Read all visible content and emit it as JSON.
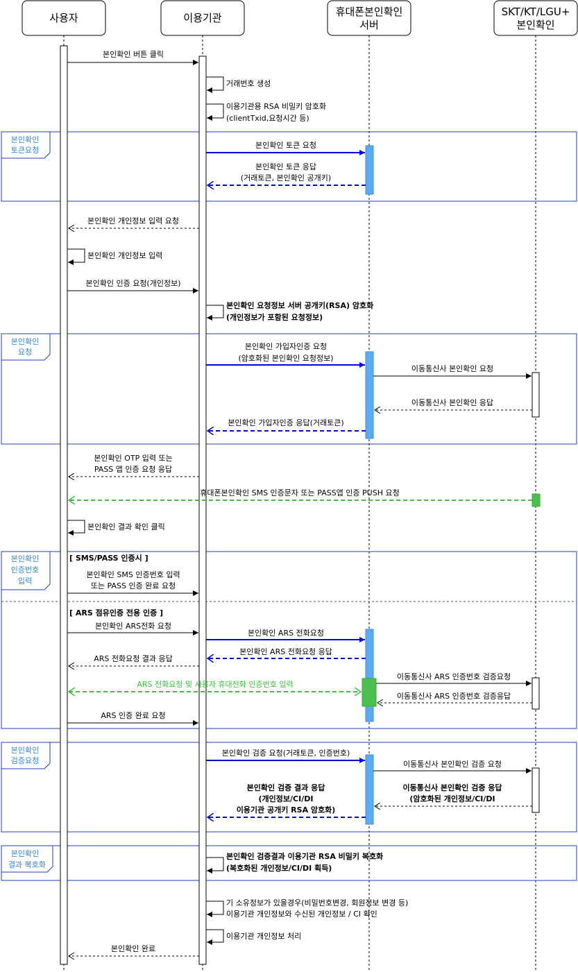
{
  "actors": [
    {
      "id": "user",
      "lines": [
        "사용자"
      ]
    },
    {
      "id": "org",
      "lines": [
        "이용기관"
      ]
    },
    {
      "id": "server",
      "lines": [
        "휴대폰본인확인",
        "서버"
      ]
    },
    {
      "id": "telco",
      "lines": [
        "SKT/KT/LGU+",
        "본인확인"
      ]
    }
  ],
  "frames": [
    {
      "id": "token",
      "lines": [
        "본인확인",
        "토큰요청"
      ]
    },
    {
      "id": "request",
      "lines": [
        "본인확인",
        "요청"
      ]
    },
    {
      "id": "authno",
      "lines": [
        "본인확인",
        "인증번호",
        "입력"
      ]
    },
    {
      "id": "verify",
      "lines": [
        "본인확인",
        "검증요청"
      ]
    },
    {
      "id": "decrypt",
      "lines": [
        "본인확인",
        "결과 복호화"
      ]
    }
  ],
  "conditions": {
    "sms_pass": "[ SMS/PASS 인증시 ]",
    "ars": "[ ARS 점유인증 전용 인증 ]"
  },
  "messages": [
    {
      "id": "m1",
      "lines": [
        "본인확인 버튼 클릭"
      ],
      "from": "user",
      "to": "org",
      "style": "solid",
      "color": "black"
    },
    {
      "id": "m2",
      "lines": [
        "거래번호 생성"
      ],
      "from": "org",
      "to": "org",
      "style": "self",
      "color": "black"
    },
    {
      "id": "m3",
      "lines": [
        "이용기관용 RSA 비밀키 암호화",
        "(clientTxid,요청시간 등)"
      ],
      "from": "org",
      "to": "org",
      "style": "self",
      "color": "black"
    },
    {
      "id": "m4",
      "lines": [
        "본인확인 토큰 요청"
      ],
      "from": "org",
      "to": "server",
      "style": "solid",
      "color": "blue"
    },
    {
      "id": "m5",
      "lines": [
        "본인확인 토큰 응답",
        "(거래토큰, 본인확인 공개키)"
      ],
      "from": "server",
      "to": "org",
      "style": "dashed",
      "color": "blue"
    },
    {
      "id": "m6",
      "lines": [
        "본인확인 개인정보 입력 요청"
      ],
      "from": "org",
      "to": "user",
      "style": "dashed",
      "color": "black"
    },
    {
      "id": "m7",
      "lines": [
        "본인확인 개인정보 입력"
      ],
      "from": "user",
      "to": "user",
      "style": "self",
      "color": "black"
    },
    {
      "id": "m8",
      "lines": [
        "본인확인 인증 요청(개인정보)"
      ],
      "from": "user",
      "to": "org",
      "style": "solid",
      "color": "black"
    },
    {
      "id": "m9",
      "lines": [
        "본인확인 요청정보 서버 공개키(RSA) 암호화",
        "(개인정보가 포함된 요청정보)"
      ],
      "from": "org",
      "to": "org",
      "style": "self",
      "color": "black",
      "bold": true
    },
    {
      "id": "m10",
      "lines": [
        "본인확인 가입자인증 요청",
        "(암호화된 본인확인 요청정보)"
      ],
      "from": "org",
      "to": "server",
      "style": "solid",
      "color": "blue"
    },
    {
      "id": "m11",
      "lines": [
        "이동통신사 본인확인 요청"
      ],
      "from": "server",
      "to": "telco",
      "style": "solid",
      "color": "black"
    },
    {
      "id": "m12",
      "lines": [
        "이동통신사 본인확인 응답"
      ],
      "from": "telco",
      "to": "server",
      "style": "dashed",
      "color": "black"
    },
    {
      "id": "m13",
      "lines": [
        "본인확인 가입자인증 응답(거래토큰)"
      ],
      "from": "server",
      "to": "org",
      "style": "dashed",
      "color": "blue"
    },
    {
      "id": "m14",
      "lines": [
        "본인확인 OTP 입력 또는",
        "PASS 앱 인증 요청 응답"
      ],
      "from": "org",
      "to": "user",
      "style": "dashed",
      "color": "black"
    },
    {
      "id": "m15",
      "lines": [
        "휴대폰본인확인  SMS 인증문자 또는 PASS앱 인증  PUSH 요청"
      ],
      "from": "telco",
      "to": "user",
      "style": "dashed",
      "color": "green"
    },
    {
      "id": "m16",
      "lines": [
        "본인확인 결과 확인 클릭"
      ],
      "from": "user",
      "to": "user",
      "style": "self",
      "color": "black"
    },
    {
      "id": "m17",
      "lines": [
        "본인확인 SMS 인증번호 입력",
        "또는 PASS 인증 완료 요청"
      ],
      "from": "user",
      "to": "org",
      "style": "solid",
      "color": "black"
    },
    {
      "id": "m18",
      "lines": [
        "본인확인 ARS전화 요청"
      ],
      "from": "user",
      "to": "org",
      "style": "solid",
      "color": "black"
    },
    {
      "id": "m19",
      "lines": [
        "본인확인 ARS 전화요청"
      ],
      "from": "org",
      "to": "server",
      "style": "solid",
      "color": "blue"
    },
    {
      "id": "m20",
      "lines": [
        "본인확인 ARS 전화요청 응답"
      ],
      "from": "server",
      "to": "org",
      "style": "dashed",
      "color": "blue"
    },
    {
      "id": "m21",
      "lines": [
        "ARS 전화요청 결과 응답"
      ],
      "from": "org",
      "to": "user",
      "style": "dashed",
      "color": "black"
    },
    {
      "id": "m22",
      "lines": [
        "이동통신사 ARS 인증번호 검증요청"
      ],
      "from": "server",
      "to": "telco",
      "style": "solid",
      "color": "black"
    },
    {
      "id": "m23",
      "lines": [
        "ARS 전화요청 및  사용자 휴대전화 인증번호 입력"
      ],
      "from": "user",
      "to": "server",
      "style": "dashed",
      "color": "green"
    },
    {
      "id": "m24",
      "lines": [
        "이동통신사 ARS 인증번호 검증응답"
      ],
      "from": "telco",
      "to": "server",
      "style": "dashed",
      "color": "black"
    },
    {
      "id": "m25",
      "lines": [
        "ARS 인증 완료 요청"
      ],
      "from": "user",
      "to": "org",
      "style": "solid",
      "color": "black"
    },
    {
      "id": "m26",
      "lines": [
        "본인확인 검증 요청(거래토큰, 인증번호)"
      ],
      "from": "org",
      "to": "server",
      "style": "solid",
      "color": "blue"
    },
    {
      "id": "m27",
      "lines": [
        "이동통신사 본인확인 검증 요청"
      ],
      "from": "server",
      "to": "telco",
      "style": "solid",
      "color": "black"
    },
    {
      "id": "m28",
      "lines": [
        "이동통신사 본인확인 검증 응답",
        "(암호화된 개인정보/CI/DI"
      ],
      "from": "telco",
      "to": "server",
      "style": "dashed",
      "color": "black",
      "bold": true
    },
    {
      "id": "m29",
      "lines": [
        "본인확인 검증 결과 응답",
        "(개인정보/CI/DI",
        "이용기관 공개키 RSA 암호화)"
      ],
      "from": "server",
      "to": "org",
      "style": "dashed",
      "color": "blue",
      "bold": true
    },
    {
      "id": "m30",
      "lines": [
        "본인확인 검증결과 이용기관 RSA 비밀키 복호화",
        "(복호화된 개인정보/CI/DI 획득)"
      ],
      "from": "org",
      "to": "org",
      "style": "self",
      "color": "black",
      "bold": true
    },
    {
      "id": "m31",
      "lines": [
        "기 소유정보가 있을경우(비밀번호변경, 회원정보 변경 등)",
        "이용기관 개인정보와 수신된 개인정보 / CI 확인"
      ],
      "from": "org",
      "to": "org",
      "style": "self",
      "color": "black"
    },
    {
      "id": "m32",
      "lines": [
        "이용기관 개인정보 처리"
      ],
      "from": "org",
      "to": "org",
      "style": "self",
      "color": "black"
    },
    {
      "id": "m33",
      "lines": [
        "본인확인 완료"
      ],
      "from": "org",
      "to": "user",
      "style": "dashed",
      "color": "black"
    }
  ],
  "colors": {
    "blue": "#0000e0",
    "green": "#3cbf3c",
    "black": "#000000",
    "frame": "#1f3fb8",
    "frame_label": "#2f86d6"
  }
}
